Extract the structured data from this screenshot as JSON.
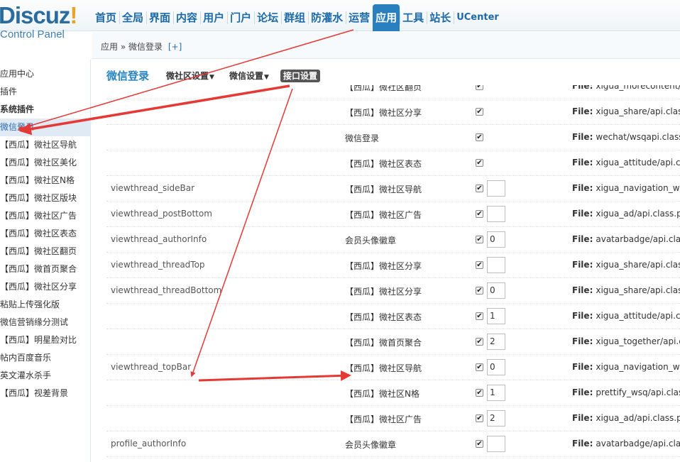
{
  "logo": {
    "name_main": "Discuz",
    "name_bang": "!",
    "subtitle": "Control Panel"
  },
  "topnav": [
    {
      "label": "首页"
    },
    {
      "label": "全局"
    },
    {
      "label": "界面"
    },
    {
      "label": "内容"
    },
    {
      "label": "用户"
    },
    {
      "label": "门户"
    },
    {
      "label": "论坛"
    },
    {
      "label": "群组"
    },
    {
      "label": "防灌水"
    },
    {
      "label": "运营"
    },
    {
      "label": "应用",
      "active": true
    },
    {
      "label": "工具"
    },
    {
      "label": "站长"
    },
    {
      "label": "UCenter"
    }
  ],
  "breadcrumb": {
    "part1": "应用",
    "sep": "»",
    "part2": "微信登录",
    "plus": "[+]"
  },
  "sidebar": [
    {
      "label": "应用中心"
    },
    {
      "label": "插件"
    },
    {
      "label": "系统插件",
      "bold": true
    },
    {
      "label": "微信登录",
      "active": true
    },
    {
      "label": "【西瓜】微社区导航"
    },
    {
      "label": "【西瓜】微社区美化"
    },
    {
      "label": "【西瓜】微社区N格"
    },
    {
      "label": "【西瓜】微社区版块"
    },
    {
      "label": "【西瓜】微社区广告"
    },
    {
      "label": "【西瓜】微社区表态"
    },
    {
      "label": "【西瓜】微社区翻页"
    },
    {
      "label": "【西瓜】微首页聚合"
    },
    {
      "label": "【西瓜】微社区分享"
    },
    {
      "label": "粘贴上传强化版"
    },
    {
      "label": "微信营销缘分测试"
    },
    {
      "label": "【西瓜】明星脸对比"
    },
    {
      "label": "帖内百度音乐"
    },
    {
      "label": "英文灌水杀手"
    },
    {
      "label": "【西瓜】视差背景"
    }
  ],
  "tabs": {
    "title": "微信登录",
    "items": [
      {
        "label": "微社区设置",
        "caret": "▼"
      },
      {
        "label": "微信设置",
        "caret": "▼"
      },
      {
        "label": "接口设置",
        "active": true
      }
    ]
  },
  "file_label": "File:",
  "rows": [
    {
      "hook": "",
      "plugin": "【西瓜】微社区翻页",
      "checked": true,
      "order": null,
      "file": "xigua_morecontent/api.class"
    },
    {
      "hook": "",
      "plugin": "【西瓜】微社区分享",
      "checked": true,
      "order": null,
      "file": "xigua_share/api.class.p"
    },
    {
      "hook": "",
      "plugin": "微信登录",
      "checked": true,
      "order": null,
      "file": "wechat/wsqapi.class.p"
    },
    {
      "hook": "",
      "plugin": "【西瓜】微社区表态",
      "checked": true,
      "order": null,
      "file": "xigua_attitude/api.class"
    },
    {
      "hook": "viewthread_sideBar",
      "plugin": "【西瓜】微社区导航",
      "checked": true,
      "order": "",
      "file": "xigua_navigation_wsq"
    },
    {
      "hook": "viewthread_postBottom",
      "plugin": "【西瓜】微社区广告",
      "checked": true,
      "order": "",
      "file": "xigua_ad/api.class.php"
    },
    {
      "hook": "viewthread_authorInfo",
      "plugin": "会员头像徽章",
      "checked": true,
      "order": "0",
      "file": "avatarbadge/api.class.p"
    },
    {
      "hook": "viewthread_threadTop",
      "plugin": "【西瓜】微社区分享",
      "checked": true,
      "order": "",
      "file": "xigua_share/api.class.p"
    },
    {
      "hook": "viewthread_threadBottom",
      "plugin": "【西瓜】微社区分享",
      "checked": true,
      "order": "0",
      "file": "xigua_share/api.class.p"
    },
    {
      "hook": "",
      "plugin": "【西瓜】微社区表态",
      "checked": true,
      "order": "1",
      "file": "xigua_attitude/api.class"
    },
    {
      "hook": "",
      "plugin": "【西瓜】微首页聚合",
      "checked": true,
      "order": "2",
      "file": "xigua_together/api.class"
    },
    {
      "hook": "viewthread_topBar",
      "plugin": "【西瓜】微社区导航",
      "checked": true,
      "order": "0",
      "file": "xigua_navigation_wsq"
    },
    {
      "hook": "",
      "plugin": "【西瓜】微社区N格",
      "checked": true,
      "order": "1",
      "file": "prettify_wsq/api.class.p"
    },
    {
      "hook": "",
      "plugin": "【西瓜】微社区广告",
      "checked": true,
      "order": "2",
      "file": "xigua_ad/api.class.php"
    },
    {
      "hook": "profile_authorInfo",
      "plugin": "会员头像徽章",
      "checked": true,
      "order": "",
      "file": "avatarbadge/api.class.p"
    }
  ],
  "annotation_color": "#e53935"
}
